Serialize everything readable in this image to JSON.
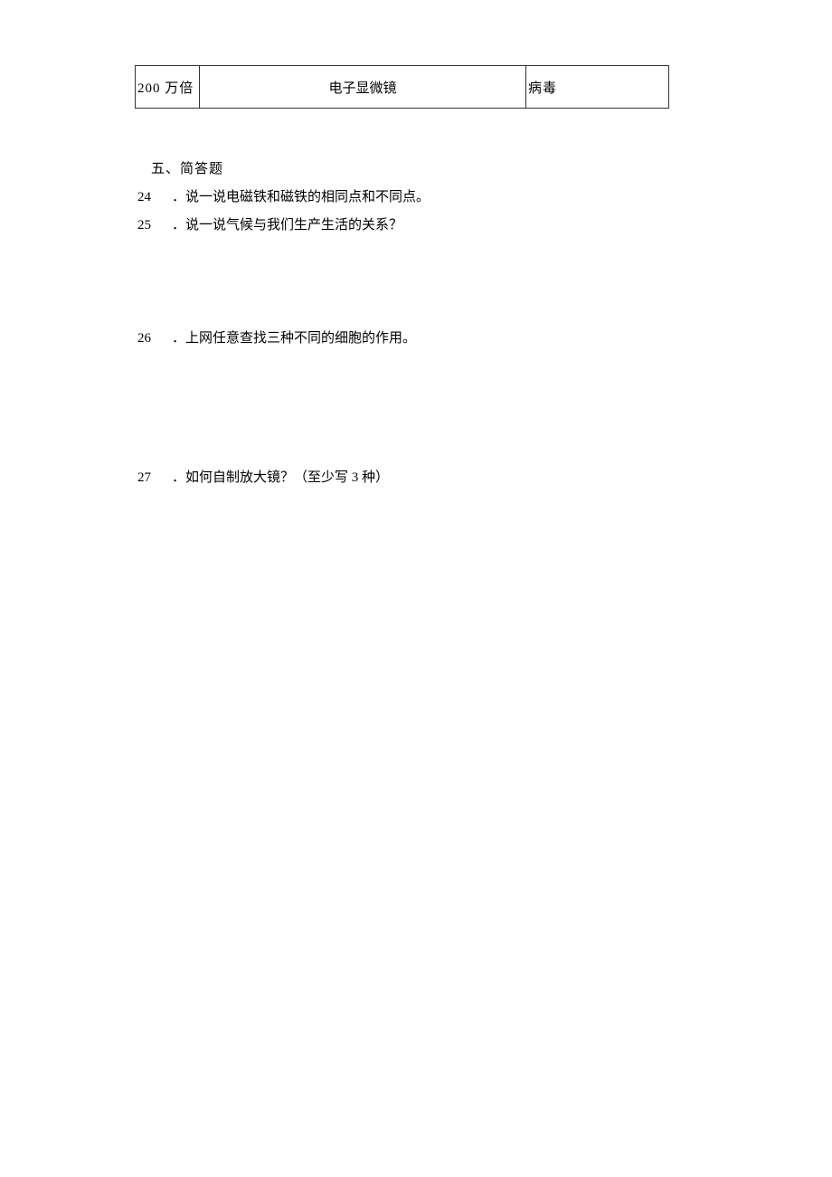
{
  "table": {
    "row": {
      "c1": "200 万倍",
      "c2": "电子显微镜",
      "c3": "病毒"
    }
  },
  "section": {
    "title": "五、简答题"
  },
  "questions": {
    "q24": {
      "num": "24",
      "text": "．说一说电磁铁和磁铁的相同点和不同点。"
    },
    "q25": {
      "num": "25",
      "text": "．说一说气候与我们生产生活的关系？"
    },
    "q26": {
      "num": "26",
      "text": "．上网任意查找三种不同的细胞的作用。"
    },
    "q27": {
      "num": "27",
      "text": "．如何自制放大镜？（至少写 3 种）"
    }
  }
}
